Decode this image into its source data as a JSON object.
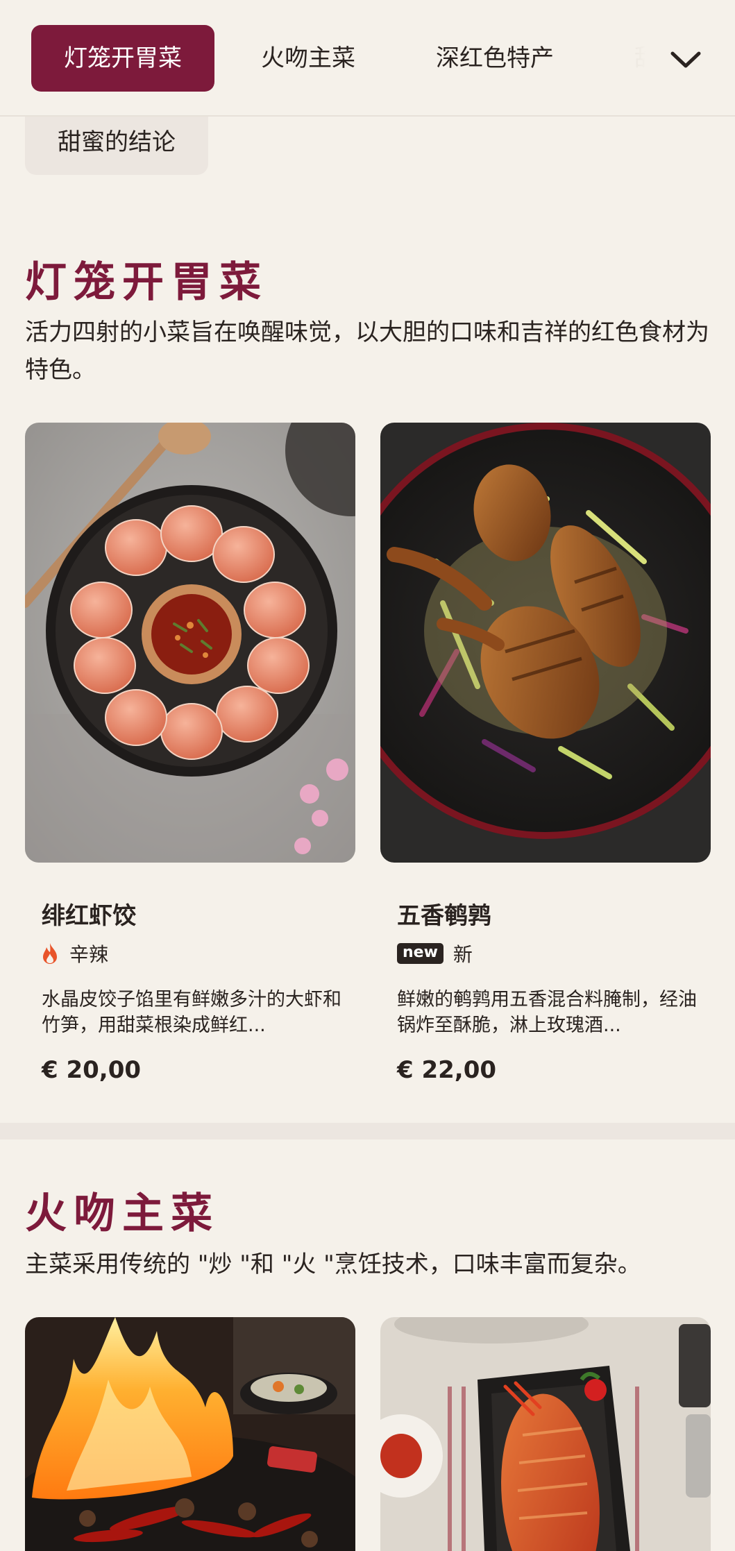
{
  "nav": {
    "tabs": [
      {
        "label": "灯笼开胃菜",
        "active": true
      },
      {
        "label": "火吻主菜",
        "active": false
      },
      {
        "label": "深红色特产",
        "active": false
      },
      {
        "label": "甜",
        "active": false
      }
    ],
    "subtab": "甜蜜的结论",
    "dropdown_icon": "chevron-down-icon"
  },
  "sections": [
    {
      "title": "灯笼开胃菜",
      "description": "活力四射的小菜旨在唤醒味觉，以大胆的口味和吉祥的红色食材为特色。",
      "items": [
        {
          "name": "绯红虾饺",
          "tag_icon": "flame-icon",
          "tag": "辛辣",
          "description": "水晶皮饺子馅里有鲜嫩多汁的大虾和竹笋，用甜菜根染成鲜红...",
          "price": "€ 20,00"
        },
        {
          "name": "五香鹌鹑",
          "badge": "new",
          "tag": "新",
          "description": "鲜嫩的鹌鹑用五香混合料腌制，经油锅炸至酥脆，淋上玫瑰酒...",
          "price": "€ 22,00"
        }
      ]
    },
    {
      "title": "火吻主菜",
      "description": "主菜采用传统的 \"炒 \"和 \"火 \"烹饪技术，口味丰富而复杂。"
    }
  ],
  "colors": {
    "brand": "#7d1a3b",
    "background": "#f5f1ea",
    "text": "#2a2320",
    "flame": "#e8542a"
  }
}
